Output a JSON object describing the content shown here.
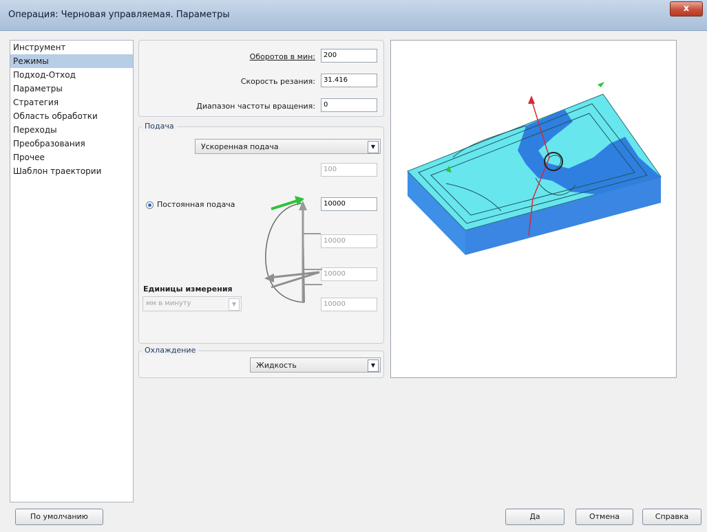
{
  "window": {
    "title": "Операция: Черновая управляемая. Параметры",
    "close_label": "x"
  },
  "nav": {
    "items": [
      {
        "label": "Инструмент",
        "selected": false
      },
      {
        "label": "Режимы",
        "selected": true
      },
      {
        "label": "Подход-Отход",
        "selected": false
      },
      {
        "label": "Параметры",
        "selected": false
      },
      {
        "label": "Стратегия",
        "selected": false
      },
      {
        "label": "Область обработки",
        "selected": false
      },
      {
        "label": "Переходы",
        "selected": false
      },
      {
        "label": "Преобразования",
        "selected": false
      },
      {
        "label": "Прочее",
        "selected": false
      },
      {
        "label": "Шаблон траектории",
        "selected": false
      }
    ]
  },
  "spindle": {
    "rpm_label": "Оборотов в мин:",
    "rpm_value": "200",
    "speed_label": "Скорость резания:",
    "speed_value": "31.416",
    "range_label": "Диапазон частоты вращения:",
    "range_value": "0"
  },
  "feed": {
    "group_title": "Подача",
    "type_selected": "Ускоренная подача",
    "rapid_value": "100",
    "constant_label": "Постоянная подача",
    "constant_value": "10000",
    "value_3": "10000",
    "value_4": "10000",
    "value_5": "10000",
    "units_label": "Единицы измерения",
    "units_selected": "мм в минуту"
  },
  "cooling": {
    "group_title": "Охлаждение",
    "selected": "Жидкость"
  },
  "buttons": {
    "default_label": "По умолчанию",
    "ok_label": "Да",
    "cancel_label": "Отмена",
    "help_label": "Справка"
  },
  "colors": {
    "selection": "#b8cde6",
    "part_top": "#67e6ee",
    "part_side": "#3f93ec",
    "pocket": "#2f7fe0",
    "path_red": "#d8283a",
    "arrow_green": "#2ec23b"
  },
  "icons": {
    "close": "close-icon",
    "dropdown": "chevron-down-icon"
  }
}
